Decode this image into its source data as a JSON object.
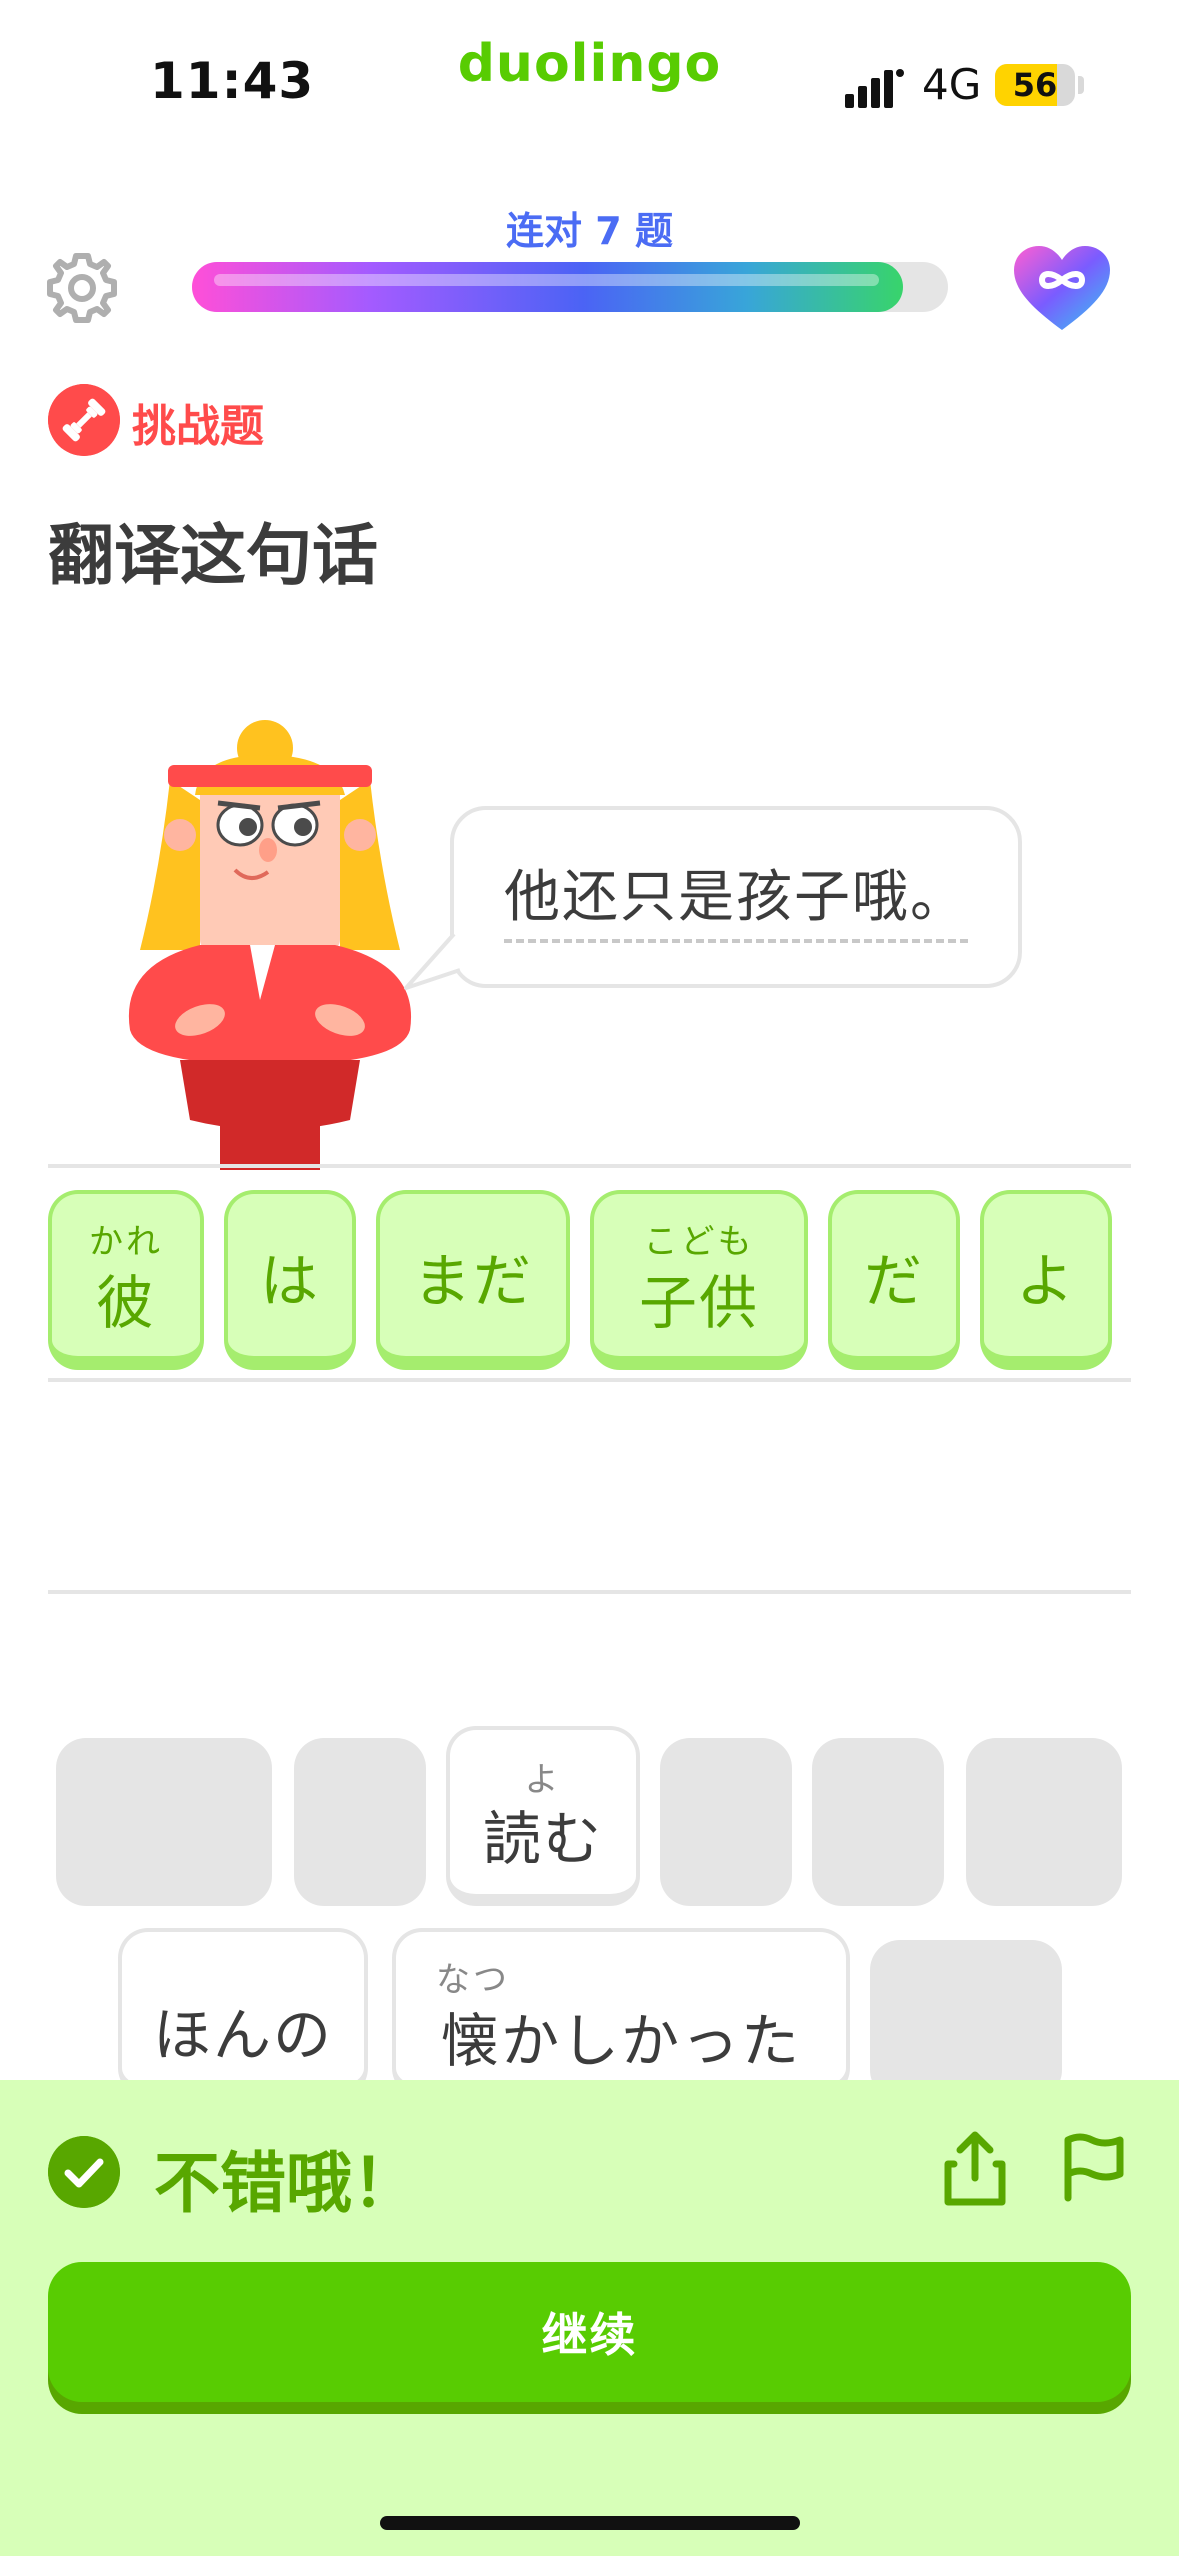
{
  "status_bar": {
    "time": "11:43",
    "network": "4G",
    "battery": "56",
    "battery_level_pct": 78
  },
  "app": {
    "brand": "duolingo"
  },
  "progress": {
    "streak_label": "连对 7 题",
    "fraction": 0.94
  },
  "icons": {
    "settings": "gear-icon",
    "hearts": "infinity-heart-icon",
    "challenge": "dumbbell-icon",
    "success": "check-icon",
    "share": "share-icon",
    "report": "flag-icon"
  },
  "header": {
    "challenge_label": "挑战题",
    "prompt": "翻译这句话"
  },
  "speech": {
    "sentence": "他还只是孩子哦。"
  },
  "answer_tiles": [
    {
      "ruby": "かれ",
      "text": "彼"
    },
    {
      "ruby": "",
      "text": "は"
    },
    {
      "ruby": "",
      "text": "まだ"
    },
    {
      "ruby": "こども",
      "text": "子供"
    },
    {
      "ruby": "",
      "text": "だ"
    },
    {
      "ruby": "",
      "text": "よ"
    }
  ],
  "word_bank": [
    {
      "ruby": "よ",
      "text": "読む"
    },
    {
      "ruby": "",
      "text": "ほんの"
    },
    {
      "ruby": "なつ",
      "text": "懐かしかった"
    }
  ],
  "feedback": {
    "message": "不错哦！",
    "continue_label": "继续"
  },
  "colors": {
    "brand_green": "#58cc02",
    "feedback_bg": "#d7ffb8",
    "feedback_green": "#58a700",
    "challenge_red": "#ff4b4b",
    "streak_blue": "#4b6cf4"
  }
}
